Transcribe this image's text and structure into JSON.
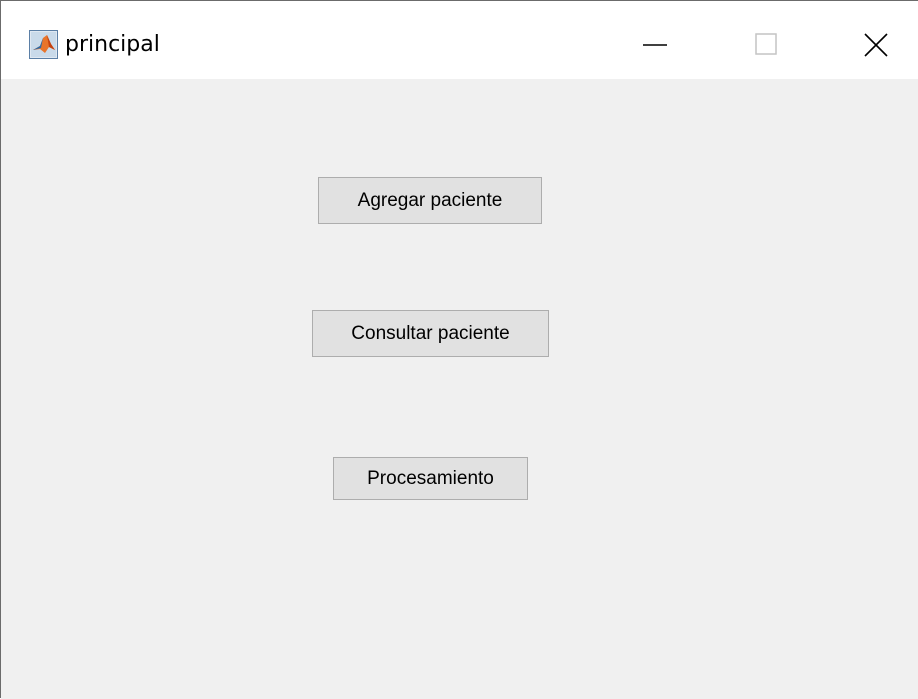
{
  "window": {
    "title": "principal",
    "app_icon": "matlab-icon",
    "controls": {
      "minimize_icon": "minimize-icon",
      "maximize_icon": "maximize-icon",
      "close_icon": "close-icon"
    }
  },
  "buttons": {
    "agregar_label": "Agregar paciente",
    "consultar_label": "Consultar paciente",
    "procesamiento_label": "Procesamiento"
  },
  "colors": {
    "client_background": "#f0f0f0",
    "button_face": "#e1e1e1",
    "button_border": "#adadad",
    "titlebar_background": "#ffffff"
  }
}
